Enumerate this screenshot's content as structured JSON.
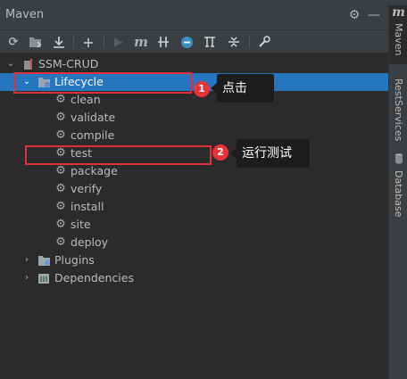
{
  "window": {
    "title": "Maven"
  },
  "toolbar": {
    "tools": [
      "refresh-icon",
      "generate-sources-icon",
      "download-icon",
      "add-icon",
      "run-icon",
      "maven-goal-icon",
      "toggle-offline-icon",
      "skip-tests-icon",
      "show-dependencies-icon",
      "collapse-all-icon",
      "settings-icon"
    ],
    "maven_symbol": "m"
  },
  "tree": {
    "project": "SSM-CRUD",
    "lifecycle": "Lifecycle",
    "goals": [
      "clean",
      "validate",
      "compile",
      "test",
      "package",
      "verify",
      "install",
      "site",
      "deploy"
    ],
    "plugins": "Plugins",
    "dependencies": "Dependencies"
  },
  "annotations": [
    {
      "number": "1",
      "text": "点击"
    },
    {
      "number": "2",
      "text": "运行测试"
    }
  ],
  "side_tabs": [
    "Maven",
    "RestServices",
    "Database"
  ],
  "colors": {
    "selected": "#2675bf",
    "annotation_red": "#e0303a"
  }
}
